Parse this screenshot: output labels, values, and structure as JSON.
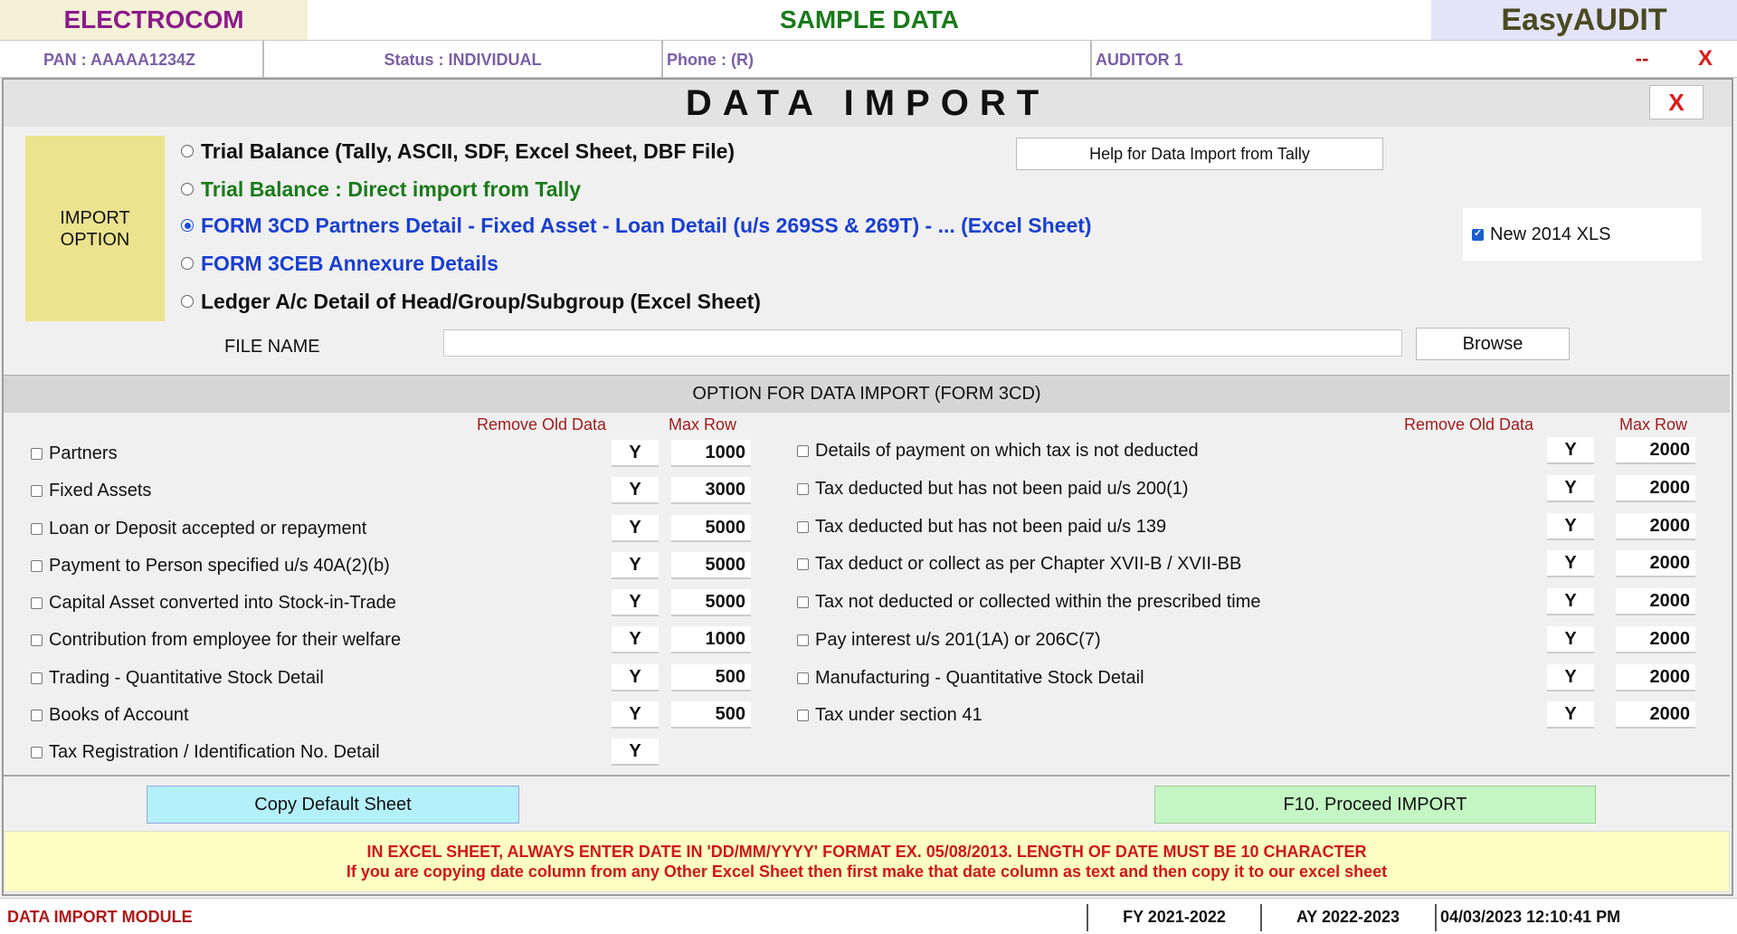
{
  "header": {
    "company": "ELECTROCOM",
    "mode": "SAMPLE DATA",
    "product": "EasyAUDIT"
  },
  "infobar": {
    "pan": "PAN  :  AAAAA1234Z",
    "status": "Status  :  INDIVIDUAL",
    "phone": "Phone  : (R)",
    "auditor": "AUDITOR 1",
    "minimize": "--",
    "close": "X"
  },
  "dialog": {
    "title": "DATA  IMPORT",
    "close": "X",
    "import_option_line1": "IMPORT",
    "import_option_line2": "OPTION",
    "options": [
      {
        "label": "Trial Balance (Tally, ASCII, SDF, Excel Sheet, DBF File)",
        "selected": false,
        "color": "#111111"
      },
      {
        "label": "Trial Balance : Direct import from Tally",
        "selected": false,
        "color": "#1a7a1a"
      },
      {
        "label": "FORM 3CD Partners Detail - Fixed Asset - Loan Detail (u/s 269SS & 269T) - ... (Excel Sheet)",
        "selected": true,
        "color": "#1a3fd0"
      },
      {
        "label": "FORM 3CEB Annexure Details",
        "selected": false,
        "color": "#1a3fd0"
      },
      {
        "label": "Ledger A/c Detail of Head/Group/Subgroup (Excel Sheet)",
        "selected": false,
        "color": "#111111"
      }
    ],
    "help_button": "Help for Data Import from Tally",
    "new_xls_label": "New 2014 XLS",
    "new_xls_checked": true,
    "file_name_label": "FILE NAME",
    "file_name_value": "",
    "browse_button": "Browse"
  },
  "import_options": {
    "title": "OPTION FOR DATA IMPORT (FORM 3CD)",
    "remove_old_header": "Remove Old Data",
    "max_row_header": "Max Row",
    "left": [
      {
        "label": "Partners",
        "remove": "Y",
        "max": "1000"
      },
      {
        "label": "Fixed Assets",
        "remove": "Y",
        "max": "3000"
      },
      {
        "label": "Loan or Deposit accepted or repayment",
        "remove": "Y",
        "max": "5000"
      },
      {
        "label": "Payment to Person specified u/s 40A(2)(b)",
        "remove": "Y",
        "max": "5000"
      },
      {
        "label": "Capital Asset converted into Stock-in-Trade",
        "remove": "Y",
        "max": "5000"
      },
      {
        "label": "Contribution from employee for their welfare",
        "remove": "Y",
        "max": "1000"
      },
      {
        "label": "Trading - Quantitative Stock Detail",
        "remove": "Y",
        "max": "500"
      },
      {
        "label": "Books of Account",
        "remove": "Y",
        "max": "500"
      },
      {
        "label": "Tax Registration / Identification No. Detail",
        "remove": "Y",
        "max": ""
      }
    ],
    "right": [
      {
        "label": "Details of payment on which tax is not deducted",
        "remove": "Y",
        "max": "2000"
      },
      {
        "label": "Tax deducted but has not been paid u/s 200(1)",
        "remove": "Y",
        "max": "2000"
      },
      {
        "label": "Tax deducted but has not been paid u/s 139",
        "remove": "Y",
        "max": "2000"
      },
      {
        "label": "Tax deduct or collect as per Chapter XVII-B / XVII-BB",
        "remove": "Y",
        "max": "2000"
      },
      {
        "label": "Tax not deducted or collected within the prescribed time",
        "remove": "Y",
        "max": "2000"
      },
      {
        "label": "Pay interest u/s 201(1A) or 206C(7)",
        "remove": "Y",
        "max": "2000"
      },
      {
        "label": "Manufacturing - Quantitative Stock Detail",
        "remove": "Y",
        "max": "2000"
      },
      {
        "label": "Tax under section 41",
        "remove": "Y",
        "max": "2000"
      }
    ]
  },
  "actions": {
    "copy_default": "Copy Default Sheet",
    "proceed": "F10. Proceed IMPORT"
  },
  "warning": {
    "line1": "IN EXCEL SHEET, ALWAYS ENTER DATE IN 'DD/MM/YYYY' FORMAT  EX. 05/08/2013. LENGTH OF DATE MUST BE 10 CHARACTER",
    "line2": "If you are copying date column from any Other Excel Sheet then first make that date column as text and then copy it to our excel sheet"
  },
  "statusbar": {
    "module": "DATA IMPORT MODULE",
    "fy": "FY 2021-2022",
    "ay": "AY 2022-2023",
    "datetime": "04/03/2023 12:10:41 PM"
  }
}
